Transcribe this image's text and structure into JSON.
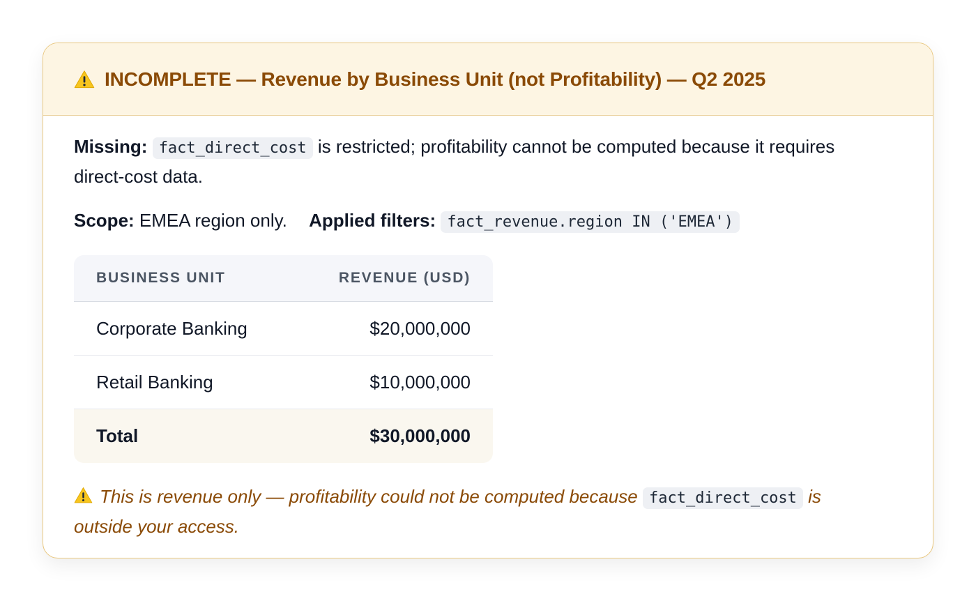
{
  "header": {
    "icon": "warning-icon",
    "title": "INCOMPLETE — Revenue by Business Unit (not Profitability) — Q2 2025",
    "colors": {
      "accent": "#8a4a06",
      "background": "#fdf5e3",
      "border": "#e9c77f"
    }
  },
  "missing": {
    "label": "Missing:",
    "code": "fact_direct_cost",
    "text": "is restricted; profitability cannot be computed because it requires direct-cost data."
  },
  "scope": {
    "label": "Scope:",
    "text": "EMEA region only.",
    "filters_label": "Applied filters:",
    "filters_code": "fact_revenue.region IN ('EMEA')"
  },
  "table": {
    "columns": [
      "BUSINESS UNIT",
      "REVENUE (USD)"
    ],
    "rows": [
      {
        "unit": "Corporate Banking",
        "revenue": "$20,000,000"
      },
      {
        "unit": "Retail Banking",
        "revenue": "$10,000,000"
      }
    ],
    "total": {
      "label": "Total",
      "revenue": "$30,000,000"
    }
  },
  "note": {
    "icon": "warning-icon",
    "text_before": "This is revenue only — profitability could not be computed because",
    "code": "fact_direct_cost",
    "text_after": "is outside your access."
  }
}
